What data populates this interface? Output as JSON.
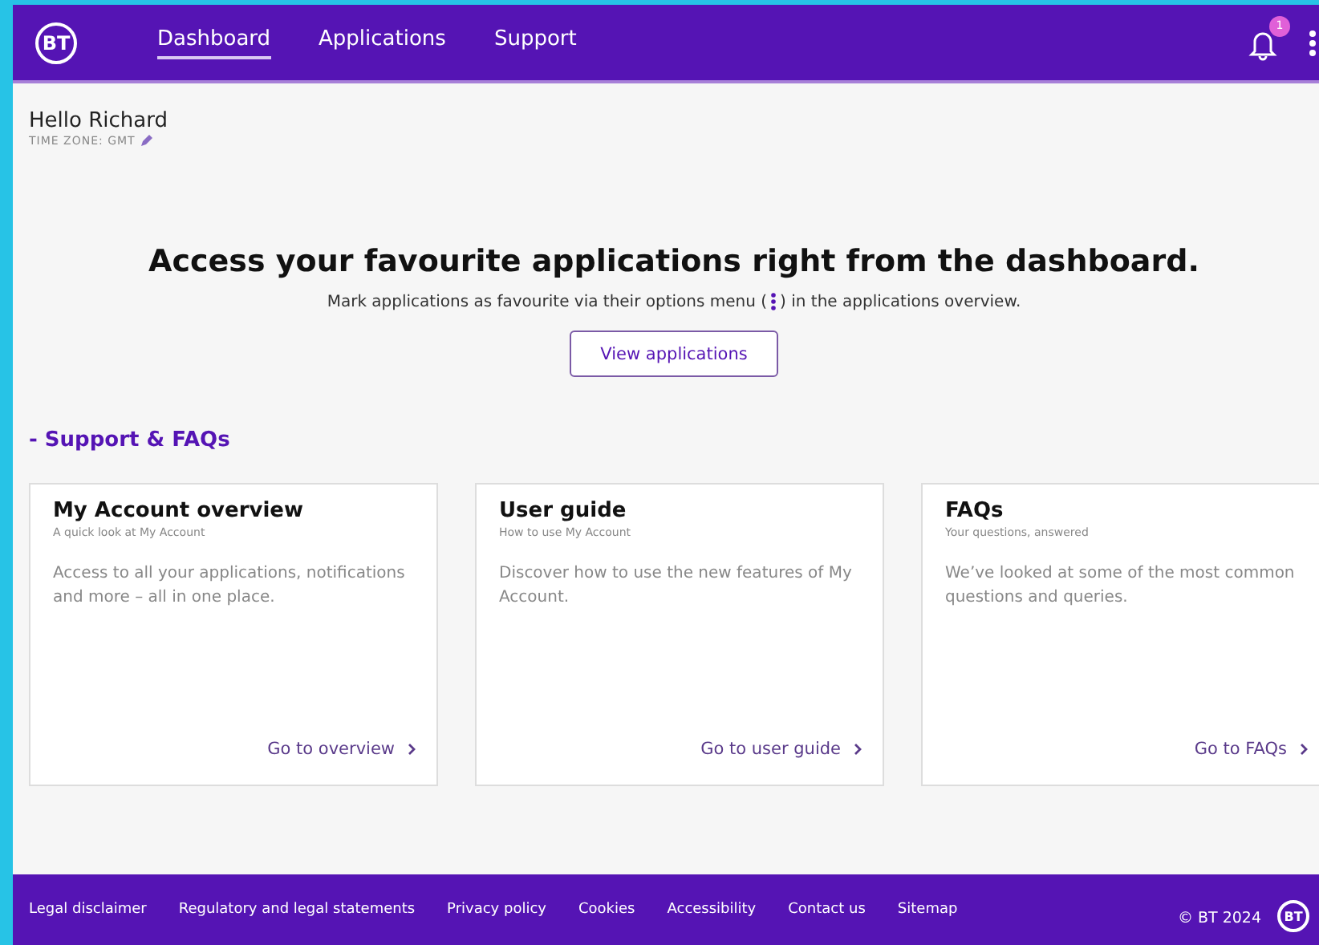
{
  "header": {
    "logo": "BT",
    "nav": [
      {
        "label": "Dashboard",
        "selected": true
      },
      {
        "label": "Applications",
        "selected": false
      },
      {
        "label": "Support",
        "selected": false
      }
    ],
    "notifications": {
      "count": "1"
    }
  },
  "greeting": {
    "title": "Hello Richard",
    "timezone": "TIME ZONE: GMT"
  },
  "hero": {
    "title": "Access your favourite applications right from the dashboard.",
    "hint_before": "Mark applications as favourite via their options menu (",
    "hint_after": ") in the applications overview.",
    "button": "View applications"
  },
  "section": {
    "title": "- Support & FAQs"
  },
  "cards": [
    {
      "title": "My Account overview",
      "subtitle": "A quick look at My Account",
      "body": "Access to all your applications, notifications and more – all in one place.",
      "link": "Go to overview"
    },
    {
      "title": "User guide",
      "subtitle": "How to use My Account",
      "body": "Discover how to use the new features of My Account.",
      "link": "Go to user guide"
    },
    {
      "title": "FAQs",
      "subtitle": "Your questions, answered",
      "body": "We’ve looked at some of the most common questions and queries.",
      "link": "Go to FAQs"
    }
  ],
  "footer": {
    "links": [
      "Legal disclaimer",
      "Regulatory and legal statements",
      "Privacy policy",
      "Cookies",
      "Accessibility",
      "Contact us",
      "Sitemap"
    ],
    "copyright": "© BT 2024",
    "logo": "BT"
  }
}
